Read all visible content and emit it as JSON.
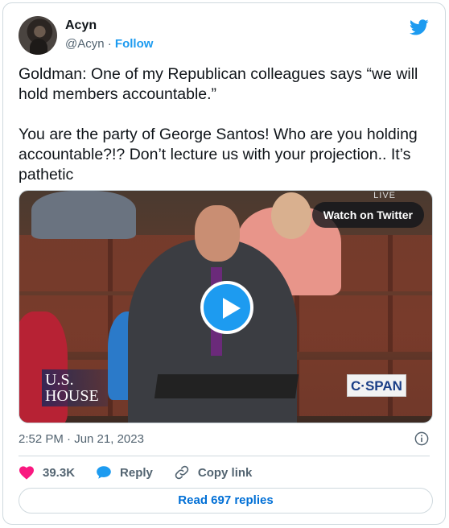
{
  "author": {
    "name": "Acyn",
    "handle": "@Acyn",
    "separator": "·",
    "follow_label": "Follow"
  },
  "tweet": {
    "text": "Goldman: One of my Republican colleagues says “we will hold members accountable.”\n\nYou are the party of George Santos! Who are you holding accountable?!? Don’t lecture us with your projection.. It’s pathetic",
    "timestamp": "2:52 PM · Jun 21, 2023"
  },
  "media": {
    "watch_label": "Watch on Twitter",
    "live_tag": "LIVE",
    "house_logo_line1": "U.S.",
    "house_logo_line2": "HOUSE",
    "network_logo": "C·SPAN"
  },
  "actions": {
    "likes": "39.3K",
    "reply_label": "Reply",
    "copy_label": "Copy link"
  },
  "read_replies_label": "Read 697 replies",
  "colors": {
    "accent": "#1d9bf0",
    "like": "#f91880",
    "muted": "#536471",
    "border": "#cfd9de"
  },
  "icons": [
    "twitter-bird-icon",
    "play-icon",
    "info-icon",
    "heart-icon",
    "reply-bubble-icon",
    "link-icon"
  ]
}
